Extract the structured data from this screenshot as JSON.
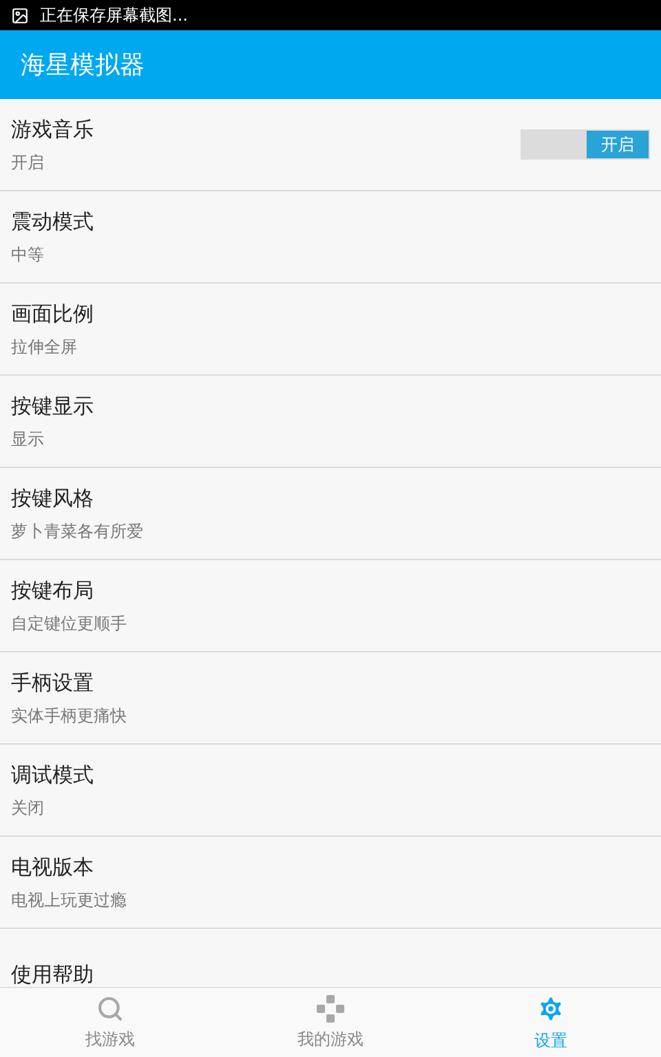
{
  "status_bar": {
    "notification": "正在保存屏幕截图..."
  },
  "app_bar": {
    "title": "海星模拟器"
  },
  "settings": [
    {
      "kind": "toggle",
      "title": "游戏音乐",
      "subtitle": "开启",
      "toggle_label": "开启",
      "on": true
    },
    {
      "kind": "plain",
      "title": "震动模式",
      "subtitle": "中等"
    },
    {
      "kind": "plain",
      "title": "画面比例",
      "subtitle": "拉伸全屏"
    },
    {
      "kind": "plain",
      "title": "按键显示",
      "subtitle": "显示"
    },
    {
      "kind": "plain",
      "title": "按键风格",
      "subtitle": "萝卜青菜各有所爱"
    },
    {
      "kind": "plain",
      "title": "按键布局",
      "subtitle": "自定键位更顺手"
    },
    {
      "kind": "plain",
      "title": "手柄设置",
      "subtitle": "实体手柄更痛快"
    },
    {
      "kind": "plain",
      "title": "调试模式",
      "subtitle": "关闭"
    },
    {
      "kind": "plain",
      "title": "电视版本",
      "subtitle": "电视上玩更过瘾"
    },
    {
      "kind": "plain",
      "title": "使用帮助"
    }
  ],
  "bottom_nav": [
    {
      "kind": "search",
      "label": "找游戏",
      "selected": false
    },
    {
      "kind": "gamepad",
      "label": "我的游戏",
      "selected": false
    },
    {
      "kind": "settings",
      "label": "设置",
      "selected": true
    }
  ]
}
